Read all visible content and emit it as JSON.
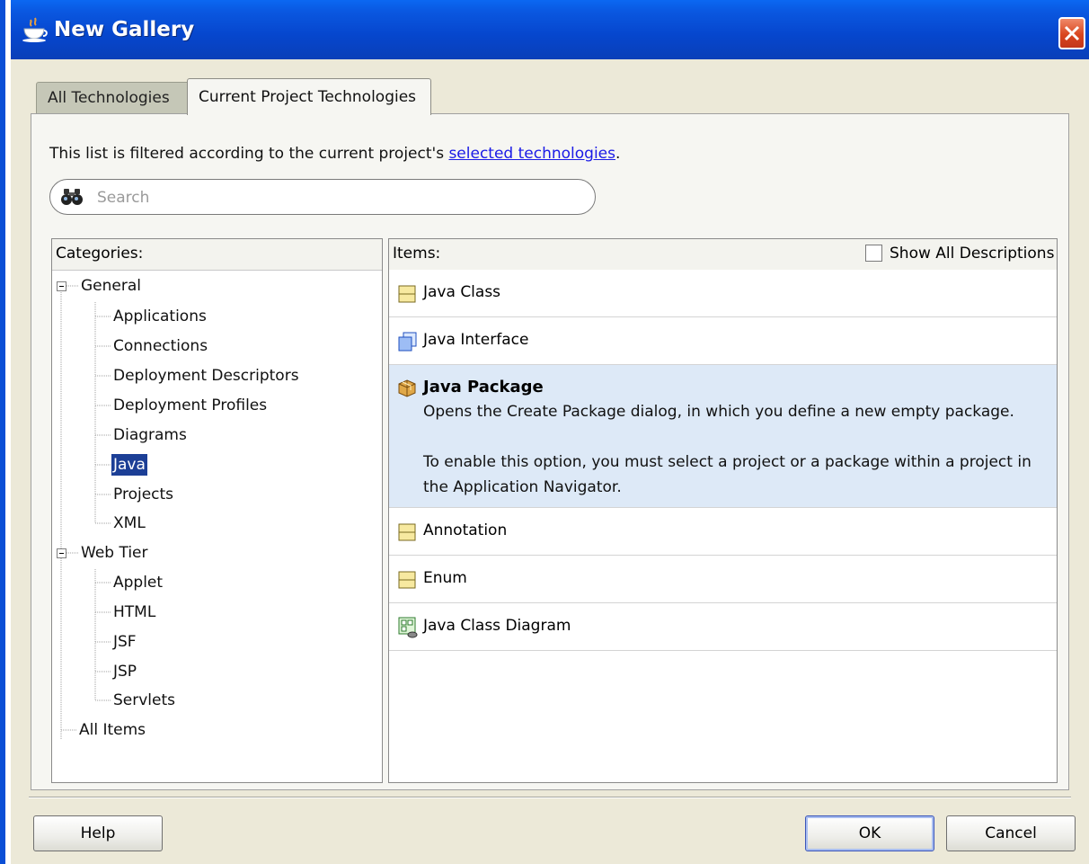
{
  "window": {
    "title": "New Gallery",
    "icon": "java-cup-icon",
    "close_icon": "close-icon"
  },
  "tabs": [
    {
      "label": "All Technologies",
      "active": false
    },
    {
      "label": "Current Project Technologies",
      "active": true
    }
  ],
  "filter": {
    "text": "This list is filtered according to the current project's ",
    "link": "selected technologies",
    "suffix": "."
  },
  "search": {
    "placeholder": "Search",
    "value": "",
    "icon": "binoculars-icon"
  },
  "categories": {
    "header": "Categories:",
    "tree": [
      {
        "label": "General",
        "expanded": true,
        "children": [
          "Applications",
          "Connections",
          "Deployment Descriptors",
          "Deployment Profiles",
          "Diagrams",
          "Java",
          "Projects",
          "XML"
        ]
      },
      {
        "label": "Web Tier",
        "expanded": true,
        "children": [
          "Applet",
          "HTML",
          "JSF",
          "JSP",
          "Servlets"
        ]
      },
      {
        "label": "All Items",
        "expanded": false,
        "children": []
      }
    ],
    "selected": "Java"
  },
  "items": {
    "header": "Items:",
    "show_all_label": "Show All Descriptions",
    "show_all_checked": false,
    "list": [
      {
        "name": "Java Class",
        "icon": "java-class-icon"
      },
      {
        "name": "Java Interface",
        "icon": "java-interface-icon"
      },
      {
        "name": "Java Package",
        "icon": "java-package-icon",
        "selected": true,
        "description_1": "Opens the Create Package dialog, in which you define a new empty package.",
        "description_2": "To enable this option, you must select a project or a package within a project in the Application Navigator."
      },
      {
        "name": "Annotation",
        "icon": "annotation-icon"
      },
      {
        "name": "Enum",
        "icon": "enum-icon"
      },
      {
        "name": "Java Class Diagram",
        "icon": "class-diagram-icon"
      }
    ]
  },
  "buttons": {
    "help": "Help",
    "ok": "OK",
    "cancel": "Cancel"
  }
}
